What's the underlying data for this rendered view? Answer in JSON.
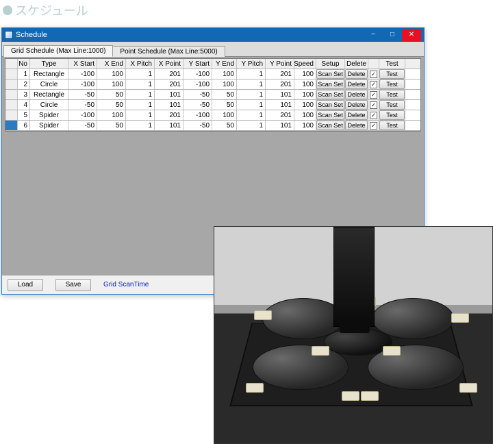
{
  "page_heading": "スケジュール",
  "window": {
    "title": "Schedule",
    "min_label": "−",
    "max_label": "□",
    "close_label": "✕"
  },
  "tabs": {
    "grid": "Grid Schedule (Max Line:1000)",
    "point": "Point Schedule (Max Line:5000)"
  },
  "columns": {
    "no": "No",
    "type": "Type",
    "xstart": "X Start",
    "xend": "X End",
    "xpitch": "X Pitch",
    "xpoint": "X Point",
    "ystart": "Y Start",
    "yend": "Y End",
    "ypitch": "Y Pitch",
    "ypoint": "Y Point",
    "speed": "Speed",
    "setup": "Setup",
    "delete": "Delete",
    "chk": "",
    "test": "Test"
  },
  "cell_buttons": {
    "setup": "Scan Set",
    "delete": "Delete",
    "test": "Test"
  },
  "rows": [
    {
      "no": "1",
      "type": "Rectangle",
      "xstart": "-100",
      "xend": "100",
      "xpitch": "1",
      "xpoint": "201",
      "ystart": "-100",
      "yend": "100",
      "ypitch": "1",
      "ypoint": "201",
      "speed": "100",
      "chk": true
    },
    {
      "no": "2",
      "type": "Circle",
      "xstart": "-100",
      "xend": "100",
      "xpitch": "1",
      "xpoint": "201",
      "ystart": "-100",
      "yend": "100",
      "ypitch": "1",
      "ypoint": "201",
      "speed": "100",
      "chk": true
    },
    {
      "no": "3",
      "type": "Rectangle",
      "xstart": "-50",
      "xend": "50",
      "xpitch": "1",
      "xpoint": "101",
      "ystart": "-50",
      "yend": "50",
      "ypitch": "1",
      "ypoint": "101",
      "speed": "100",
      "chk": true
    },
    {
      "no": "4",
      "type": "Circle",
      "xstart": "-50",
      "xend": "50",
      "xpitch": "1",
      "xpoint": "101",
      "ystart": "-50",
      "yend": "50",
      "ypitch": "1",
      "ypoint": "101",
      "speed": "100",
      "chk": true
    },
    {
      "no": "5",
      "type": "Spider",
      "xstart": "-100",
      "xend": "100",
      "xpitch": "1",
      "xpoint": "201",
      "ystart": "-100",
      "yend": "100",
      "ypitch": "1",
      "ypoint": "201",
      "speed": "100",
      "chk": true
    },
    {
      "no": "6",
      "type": "Spider",
      "xstart": "-50",
      "xend": "50",
      "xpitch": "1",
      "xpoint": "101",
      "ystart": "-50",
      "yend": "50",
      "ypitch": "1",
      "ypoint": "101",
      "speed": "100",
      "chk": true
    }
  ],
  "bottom": {
    "load": "Load",
    "save": "Save",
    "scantime": "Grid ScanTime"
  }
}
